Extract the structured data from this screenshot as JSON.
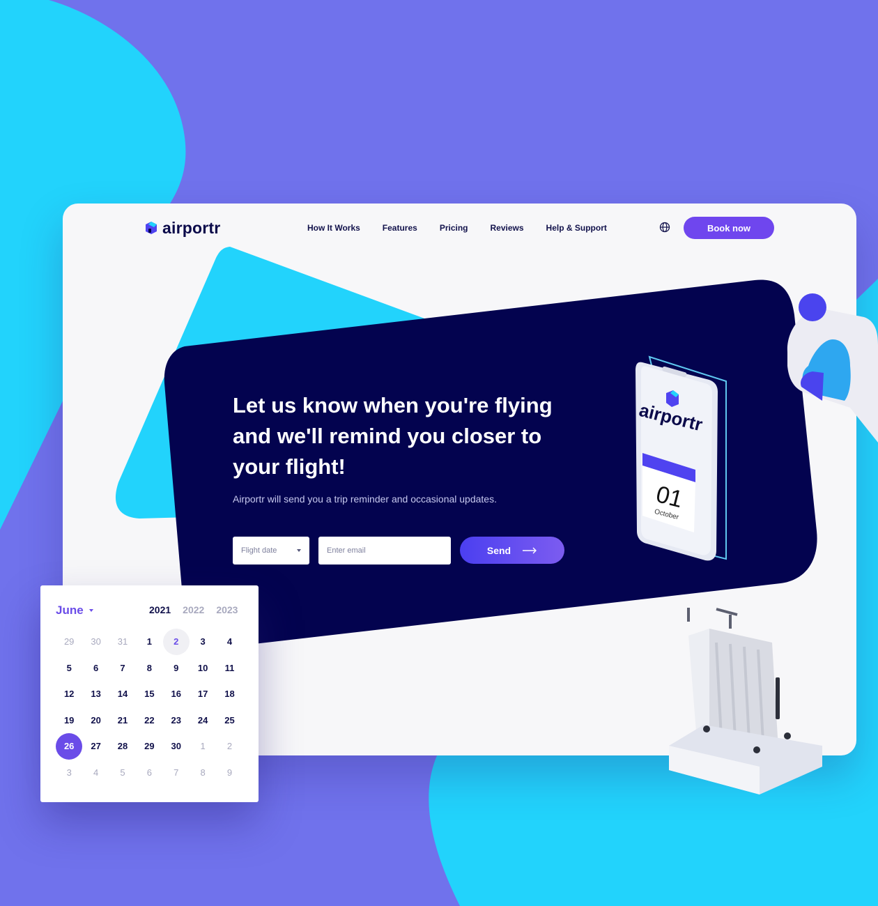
{
  "brand": {
    "name": "airportr"
  },
  "nav": {
    "items": [
      {
        "label": "How It Works"
      },
      {
        "label": "Features"
      },
      {
        "label": "Pricing"
      },
      {
        "label": "Reviews"
      },
      {
        "label": "Help & Support"
      }
    ],
    "language_icon": "globe-icon",
    "cta_label": "Book now"
  },
  "hero": {
    "title": "Let us know when you're flying and we'll remind you closer to your flight!",
    "subtitle": "Airportr will send you a trip reminder and occasional updates.",
    "date_placeholder": "Flight date",
    "email_placeholder": "Enter email",
    "send_label": "Send"
  },
  "phone_illustration": {
    "brand": "airportr",
    "day": "01",
    "month": "October"
  },
  "calendar": {
    "month": "June",
    "years": [
      "2021",
      "2022",
      "2023"
    ],
    "active_year": "2021",
    "weeks": [
      [
        "29",
        "30",
        "31",
        "1",
        "2",
        "3",
        "4"
      ],
      [
        "5",
        "6",
        "7",
        "8",
        "9",
        "10",
        "11"
      ],
      [
        "12",
        "13",
        "14",
        "15",
        "16",
        "17",
        "18"
      ],
      [
        "19",
        "20",
        "21",
        "22",
        "23",
        "24",
        "25"
      ],
      [
        "26",
        "27",
        "28",
        "29",
        "30",
        "1",
        "2"
      ],
      [
        "3",
        "4",
        "5",
        "6",
        "7",
        "8",
        "9"
      ]
    ],
    "today": "2",
    "selected": "26"
  },
  "colors": {
    "background": "#7072ec",
    "cyan": "#22d3fc",
    "navy": "#03034f",
    "accent": "#6f46ee"
  }
}
